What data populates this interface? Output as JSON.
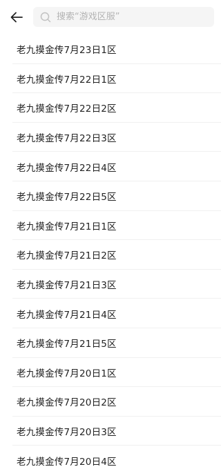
{
  "header": {
    "back_icon": "arrow-left-icon",
    "search": {
      "icon": "search-icon",
      "placeholder": "搜索“游戏区服”",
      "value": ""
    }
  },
  "servers": [
    "老九摸金传7月23日1区",
    "老九摸金传7月22日1区",
    "老九摸金传7月22日2区",
    "老九摸金传7月22日3区",
    "老九摸金传7月22日4区",
    "老九摸金传7月22日5区",
    "老九摸金传7月21日1区",
    "老九摸金传7月21日2区",
    "老九摸金传7月21日3区",
    "老九摸金传7月21日4区",
    "老九摸金传7月21日5区",
    "老九摸金传7月20日1区",
    "老九摸金传7月20日2区",
    "老九摸金传7月20日3区",
    "老九摸金传7月20日4区"
  ]
}
